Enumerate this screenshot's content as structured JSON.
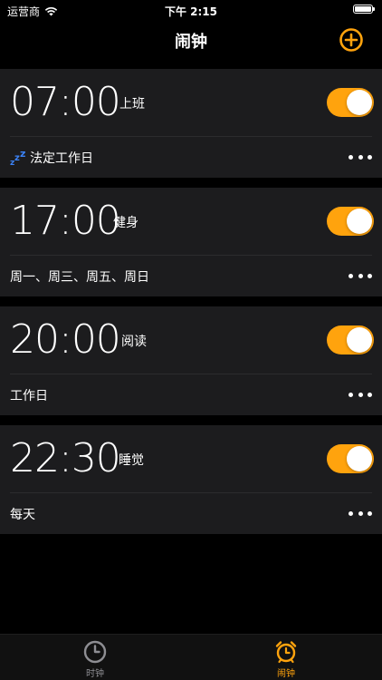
{
  "status_bar": {
    "carrier": "运营商",
    "time": "下午 2:15",
    "battery_level": 1.0
  },
  "nav": {
    "title": "闹钟",
    "add_icon": "plus-circle-icon"
  },
  "colors": {
    "accent": "#ffa30d",
    "card": "#1c1c1e",
    "background": "#000000",
    "inactive": "#8e8e93"
  },
  "alarms": [
    {
      "time": "07:00",
      "label": "上班",
      "repeat": "法定工作日",
      "repeat_icon": "zzz-icon",
      "enabled": true
    },
    {
      "time": "17:00",
      "label": "健身",
      "repeat": "周一、周三、周五、周日",
      "enabled": true
    },
    {
      "time": "20:00",
      "label": "阅读",
      "repeat": "工作日",
      "enabled": true
    },
    {
      "time": "22:30",
      "label": "睡觉",
      "repeat": "每天",
      "enabled": true
    }
  ],
  "tabs": [
    {
      "label": "时钟",
      "icon": "clock-icon",
      "selected": false
    },
    {
      "label": "闹钟",
      "icon": "alarm-clock-icon",
      "selected": true
    }
  ]
}
